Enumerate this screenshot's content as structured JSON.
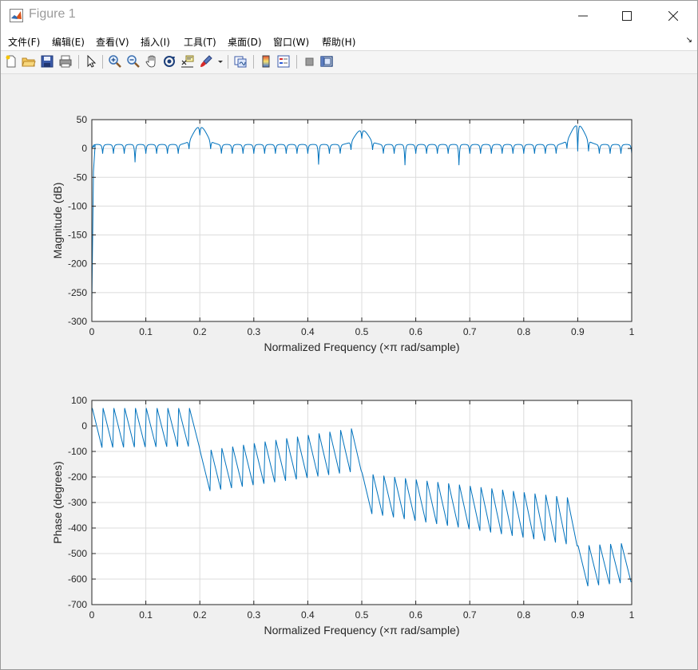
{
  "window": {
    "title": "Figure 1",
    "controls": {
      "minimize": "—",
      "maximize": "☐",
      "close": "✕"
    }
  },
  "menu": {
    "items": [
      "文件(F)",
      "编辑(E)",
      "查看(V)",
      "插入(I)",
      "工具(T)",
      "桌面(D)",
      "窗口(W)",
      "帮助(H)"
    ],
    "overflow_icon": "arrow-icon"
  },
  "toolbar": {
    "buttons": [
      "new-figure-icon",
      "open-file-icon",
      "save-icon",
      "print-icon",
      "pointer-icon",
      "zoom-in-icon",
      "zoom-out-icon",
      "pan-icon",
      "rotate-3d-icon",
      "data-cursor-icon",
      "brush-icon",
      "link-plot-icon",
      "colorbar-icon",
      "legend-icon",
      "hide-plot-tools-icon",
      "show-plot-tools-icon"
    ]
  },
  "chart_data": [
    {
      "type": "line",
      "xlabel": "Normalized Frequency  (×π rad/sample)",
      "ylabel": "Magnitude (dB)",
      "xlim": [
        0,
        1
      ],
      "ylim": [
        -300,
        50
      ],
      "xticks": [
        "0",
        "0.1",
        "0.2",
        "0.3",
        "0.4",
        "0.5",
        "0.6",
        "0.7",
        "0.8",
        "0.9",
        "1"
      ],
      "yticks": [
        "50",
        "0",
        "-50",
        "-100",
        "-150",
        "-200",
        "-250",
        "-300"
      ],
      "grid": true,
      "color": "#0072bd",
      "peaks": [
        [
          0.2,
          39
        ],
        [
          0.5,
          33
        ],
        [
          0.9,
          42
        ]
      ],
      "notches": [
        [
          0.08,
          -22
        ],
        [
          0.16,
          -7
        ],
        [
          0.42,
          -26
        ],
        [
          0.58,
          -27
        ],
        [
          0.68,
          -27
        ],
        [
          0.91,
          -3
        ]
      ],
      "min_point": [
        0.0,
        -268
      ],
      "floor": 7,
      "lobe_count": 50
    },
    {
      "type": "line",
      "xlabel": "Normalized Frequency  (×π rad/sample)",
      "ylabel": "Phase (degrees)",
      "xlim": [
        0,
        1
      ],
      "ylim": [
        -700,
        100
      ],
      "xticks": [
        "0",
        "0.1",
        "0.2",
        "0.3",
        "0.4",
        "0.5",
        "0.6",
        "0.7",
        "0.8",
        "0.9",
        "1"
      ],
      "yticks": [
        "100",
        "0",
        "-100",
        "-200",
        "-300",
        "-400",
        "-500",
        "-600",
        "-700"
      ],
      "grid": true,
      "color": "#0072bd",
      "segments": [
        {
          "x0": 0.0,
          "x1": 0.2,
          "start": 70,
          "end": -80,
          "top_start": 70,
          "top_end": 70,
          "bottom_start": -85,
          "bottom_end": -80,
          "teeth": 10
        },
        {
          "x0": 0.2,
          "x1": 0.5,
          "start": -10,
          "end": -330,
          "top_start": -100,
          "top_end": -10,
          "bottom_start": -255,
          "bottom_end": -175,
          "teeth": 15
        },
        {
          "x0": 0.5,
          "x1": 0.9,
          "start": -190,
          "end": -560,
          "top_start": -185,
          "top_end": -280,
          "bottom_start": -345,
          "bottom_end": -470,
          "teeth": 20
        },
        {
          "x0": 0.9,
          "x1": 1.0,
          "start": -610,
          "end": -610,
          "top_start": -470,
          "top_end": -460,
          "bottom_start": -628,
          "bottom_end": -612,
          "teeth": 5
        }
      ]
    }
  ]
}
